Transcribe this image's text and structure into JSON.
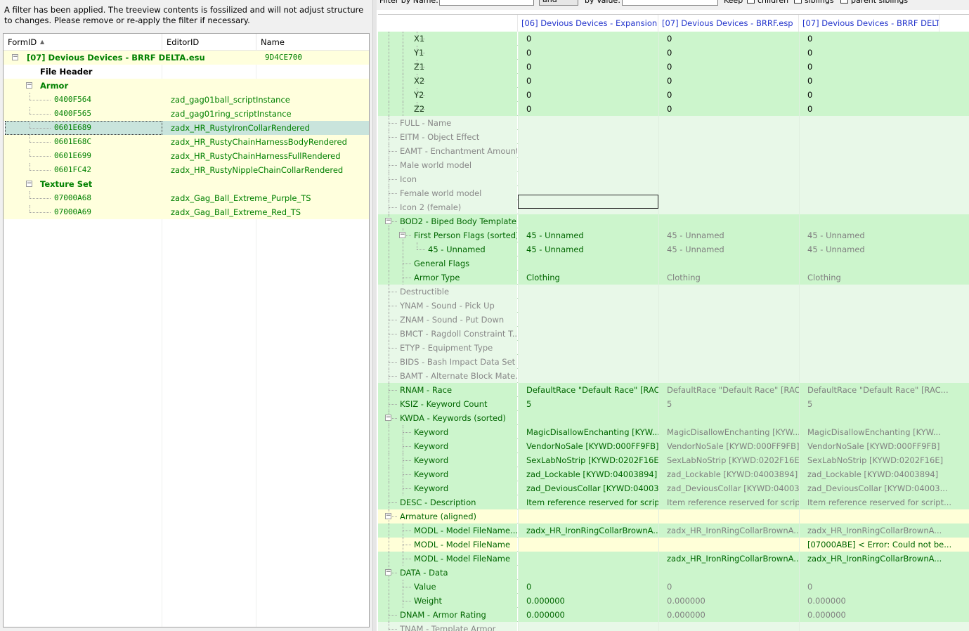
{
  "notice": "A filter has been applied. The treeview contents is fossilized and will not adjust structure to changes.  Please remove or re-apply the filter if necessary.",
  "tree": {
    "columns": [
      "FormID",
      "EditorID",
      "Name"
    ],
    "rows": [
      {
        "kind": "plugin",
        "formid": "[07] Devious Devices - BRRF DELTA.esu",
        "editor": "",
        "name": "9D4CE700",
        "expand": "-"
      },
      {
        "kind": "header",
        "formid": "File Header",
        "editor": "",
        "name": ""
      },
      {
        "kind": "group",
        "formid": "Armor",
        "editor": "",
        "name": "",
        "expand": "-"
      },
      {
        "kind": "record",
        "formid": "0400F564",
        "editor": "zad_gag01ball_scriptInstance",
        "name": ""
      },
      {
        "kind": "record",
        "formid": "0400F565",
        "editor": "zad_gag01ring_scriptInstance",
        "name": ""
      },
      {
        "kind": "record",
        "formid": "0601E689",
        "editor": "zadx_HR_RustyIronCollarRendered",
        "name": "",
        "selected": true
      },
      {
        "kind": "record",
        "formid": "0601E68C",
        "editor": "zadx_HR_RustyChainHarnessBodyRendered",
        "name": ""
      },
      {
        "kind": "record",
        "formid": "0601E699",
        "editor": "zadx_HR_RustyChainHarnessFullRendered",
        "name": ""
      },
      {
        "kind": "record",
        "formid": "0601FC42",
        "editor": "zadx_HR_RustyNippleChainCollarRendered",
        "name": ""
      },
      {
        "kind": "group",
        "formid": "Texture Set",
        "editor": "",
        "name": "",
        "expand": "-"
      },
      {
        "kind": "record",
        "formid": "07000A68",
        "editor": "zadx_Gag_Ball_Extreme_Purple_TS",
        "name": ""
      },
      {
        "kind": "record",
        "formid": "07000A69",
        "editor": "zadx_Gag_Ball_Extreme_Red_TS",
        "name": ""
      }
    ]
  },
  "filterbar": {
    "by_name": "Filter by Name:",
    "by_value": "by Value:",
    "mode": "and",
    "keep": "Keep",
    "children": "children",
    "siblings": "siblings",
    "parent_siblings": "parent siblings"
  },
  "grid": {
    "columns": [
      "[06] Devious Devices - Expansion....",
      "[07] Devious Devices - BRRF.esp",
      "[07] Devious Devices - BRRF DELT..."
    ],
    "rows": [
      {
        "label": "X1",
        "indent": 3,
        "bg": "g",
        "lc": "dk",
        "v": [
          "0",
          "0",
          "0"
        ],
        "vc": "bl"
      },
      {
        "label": "Y1",
        "indent": 3,
        "bg": "g",
        "lc": "dk",
        "v": [
          "0",
          "0",
          "0"
        ],
        "vc": "bl"
      },
      {
        "label": "Z1",
        "indent": 3,
        "bg": "g",
        "lc": "dk",
        "v": [
          "0",
          "0",
          "0"
        ],
        "vc": "bl"
      },
      {
        "label": "X2",
        "indent": 3,
        "bg": "g",
        "lc": "dk",
        "v": [
          "0",
          "0",
          "0"
        ],
        "vc": "bl"
      },
      {
        "label": "Y2",
        "indent": 3,
        "bg": "g",
        "lc": "dk",
        "v": [
          "0",
          "0",
          "0"
        ],
        "vc": "bl"
      },
      {
        "label": "Z2",
        "indent": 3,
        "bg": "g",
        "lc": "dk",
        "v": [
          "0",
          "0",
          "0"
        ],
        "vc": "bl"
      },
      {
        "label": "FULL - Name",
        "indent": 1,
        "bg": "lg",
        "lc": "gr",
        "v": [
          "",
          "",
          ""
        ],
        "vc": "bl"
      },
      {
        "label": "EITM - Object Effect",
        "indent": 1,
        "bg": "lg",
        "lc": "gr",
        "v": [
          "",
          "",
          ""
        ],
        "vc": "bl"
      },
      {
        "label": "EAMT - Enchantment Amount",
        "indent": 1,
        "bg": "lg",
        "lc": "gr",
        "v": [
          "",
          "",
          ""
        ],
        "vc": "bl"
      },
      {
        "label": "Male world model",
        "indent": 1,
        "bg": "lg",
        "lc": "gr",
        "v": [
          "",
          "",
          ""
        ],
        "vc": "bl"
      },
      {
        "label": "Icon",
        "indent": 1,
        "bg": "lg",
        "lc": "gr",
        "v": [
          "",
          "",
          ""
        ],
        "vc": "bl"
      },
      {
        "label": "Female world model",
        "indent": 1,
        "bg": "lg",
        "lc": "gr",
        "v": [
          "",
          "",
          ""
        ],
        "vc": "bl"
      },
      {
        "label": "Icon 2 (female)",
        "indent": 1,
        "bg": "lg",
        "lc": "gr",
        "v": [
          "",
          "",
          ""
        ],
        "vc": "bl"
      },
      {
        "label": "BOD2 - Biped Body Template",
        "indent": 1,
        "bg": "g",
        "lc": "nm",
        "v": [
          "",
          "",
          ""
        ],
        "vc": "bl",
        "expand": "-"
      },
      {
        "label": "First Person Flags (sorted)",
        "indent": 2,
        "bg": "g",
        "lc": "nm",
        "v": [
          "45 - Unnamed",
          "45 - Unnamed",
          "45 - Unnamed"
        ],
        "vc": "mix",
        "expand": "-"
      },
      {
        "label": "45 - Unnamed",
        "indent": 3,
        "bg": "g",
        "lc": "nm",
        "v": [
          "45 - Unnamed",
          "45 - Unnamed",
          "45 - Unnamed"
        ],
        "vc": "mix"
      },
      {
        "label": "General Flags",
        "indent": 2,
        "bg": "g",
        "lc": "nm",
        "v": [
          "",
          "",
          ""
        ],
        "vc": "bl"
      },
      {
        "label": "Armor Type",
        "indent": 2,
        "bg": "g",
        "lc": "nm",
        "v": [
          "Clothing",
          "Clothing",
          "Clothing"
        ],
        "vc": "mix"
      },
      {
        "label": "Destructible",
        "indent": 1,
        "bg": "lg",
        "lc": "gr",
        "v": [
          "",
          "",
          ""
        ],
        "vc": "bl"
      },
      {
        "label": "YNAM - Sound - Pick Up",
        "indent": 1,
        "bg": "lg",
        "lc": "gr",
        "v": [
          "",
          "",
          ""
        ],
        "vc": "bl"
      },
      {
        "label": "ZNAM - Sound - Put Down",
        "indent": 1,
        "bg": "lg",
        "lc": "gr",
        "v": [
          "",
          "",
          ""
        ],
        "vc": "bl"
      },
      {
        "label": "BMCT - Ragdoll Constraint T...",
        "indent": 1,
        "bg": "lg",
        "lc": "gr",
        "v": [
          "",
          "",
          ""
        ],
        "vc": "bl"
      },
      {
        "label": "ETYP - Equipment Type",
        "indent": 1,
        "bg": "lg",
        "lc": "gr",
        "v": [
          "",
          "",
          ""
        ],
        "vc": "bl"
      },
      {
        "label": "BIDS - Bash Impact Data Set",
        "indent": 1,
        "bg": "lg",
        "lc": "gr",
        "v": [
          "",
          "",
          ""
        ],
        "vc": "bl"
      },
      {
        "label": "BAMT - Alternate Block Mate...",
        "indent": 1,
        "bg": "lg",
        "lc": "gr",
        "v": [
          "",
          "",
          ""
        ],
        "vc": "bl"
      },
      {
        "label": "RNAM - Race",
        "indent": 1,
        "bg": "g",
        "lc": "nm",
        "v": [
          "DefaultRace \"Default Race\" [RAC...",
          "DefaultRace \"Default Race\" [RAC...",
          "DefaultRace \"Default Race\" [RAC..."
        ],
        "vc": "mix"
      },
      {
        "label": "KSIZ - Keyword Count",
        "indent": 1,
        "bg": "g",
        "lc": "nm",
        "v": [
          "5",
          "5",
          "5"
        ],
        "vc": "mix"
      },
      {
        "label": "KWDA - Keywords (sorted)",
        "indent": 1,
        "bg": "g",
        "lc": "nm",
        "v": [
          "",
          "",
          ""
        ],
        "vc": "bl",
        "expand": "-"
      },
      {
        "label": "Keyword",
        "indent": 2,
        "bg": "g",
        "lc": "nm",
        "v": [
          "MagicDisallowEnchanting [KYW...",
          "MagicDisallowEnchanting [KYW...",
          "MagicDisallowEnchanting [KYW..."
        ],
        "vc": "mix"
      },
      {
        "label": "Keyword",
        "indent": 2,
        "bg": "g",
        "lc": "nm",
        "v": [
          "VendorNoSale [KYWD:000FF9FB]",
          "VendorNoSale [KYWD:000FF9FB]",
          "VendorNoSale [KYWD:000FF9FB]"
        ],
        "vc": "mix"
      },
      {
        "label": "Keyword",
        "indent": 2,
        "bg": "g",
        "lc": "nm",
        "v": [
          "SexLabNoStrip [KYWD:0202F16E]",
          "SexLabNoStrip [KYWD:0202F16E]",
          "SexLabNoStrip [KYWD:0202F16E]"
        ],
        "vc": "mix"
      },
      {
        "label": "Keyword",
        "indent": 2,
        "bg": "g",
        "lc": "nm",
        "v": [
          "zad_Lockable [KYWD:04003894]",
          "zad_Lockable [KYWD:04003894]",
          "zad_Lockable [KYWD:04003894]"
        ],
        "vc": "mix"
      },
      {
        "label": "Keyword",
        "indent": 2,
        "bg": "g",
        "lc": "nm",
        "v": [
          "zad_DeviousCollar [KYWD:04003...",
          "zad_DeviousCollar [KYWD:04003...",
          "zad_DeviousCollar [KYWD:04003..."
        ],
        "vc": "mix"
      },
      {
        "label": "DESC - Description",
        "indent": 1,
        "bg": "g",
        "lc": "nm",
        "v": [
          "Item reference reserved for script...",
          "Item reference reserved for script...",
          "Item reference reserved for script..."
        ],
        "vc": "mix"
      },
      {
        "label": "Armature (aligned)",
        "indent": 1,
        "bg": "y",
        "lc": "nm",
        "v": [
          "",
          "",
          ""
        ],
        "vc": "bl",
        "expand": "-"
      },
      {
        "label": "MODL - Model FileName...",
        "indent": 2,
        "bg": "g",
        "lc": "nm",
        "v": [
          "zadx_HR_IronRingCollarBrownA...",
          "zadx_HR_IronRingCollarBrownA...",
          "zadx_HR_IronRingCollarBrownA..."
        ],
        "vc": "mix"
      },
      {
        "label": "MODL - Model FileName",
        "indent": 2,
        "bg": "y",
        "lc": "nm",
        "v": [
          "",
          "",
          "[07000ABE] < Error: Could not be..."
        ],
        "vc": "bl"
      },
      {
        "label": "MODL - Model FileName",
        "indent": 2,
        "bg": "g",
        "lc": "nm",
        "v": [
          "",
          "zadx_HR_IronRingCollarBrownA...",
          "zadx_HR_IronRingCollarBrownA..."
        ],
        "vc": "bl"
      },
      {
        "label": "DATA - Data",
        "indent": 1,
        "bg": "g",
        "lc": "nm",
        "v": [
          "",
          "",
          ""
        ],
        "vc": "bl",
        "expand": "-"
      },
      {
        "label": "Value",
        "indent": 2,
        "bg": "g",
        "lc": "nm",
        "v": [
          "0",
          "0",
          "0"
        ],
        "vc": "mix"
      },
      {
        "label": "Weight",
        "indent": 2,
        "bg": "g",
        "lc": "nm",
        "v": [
          "0.000000",
          "0.000000",
          "0.000000"
        ],
        "vc": "mix"
      },
      {
        "label": "DNAM - Armor Rating",
        "indent": 1,
        "bg": "g",
        "lc": "nm",
        "v": [
          "0.000000",
          "0.000000",
          "0.000000"
        ],
        "vc": "mix"
      },
      {
        "label": "TNAM - Template Armor",
        "indent": 1,
        "bg": "lg",
        "lc": "gr",
        "v": [
          "",
          "",
          ""
        ],
        "vc": "bl"
      }
    ]
  }
}
